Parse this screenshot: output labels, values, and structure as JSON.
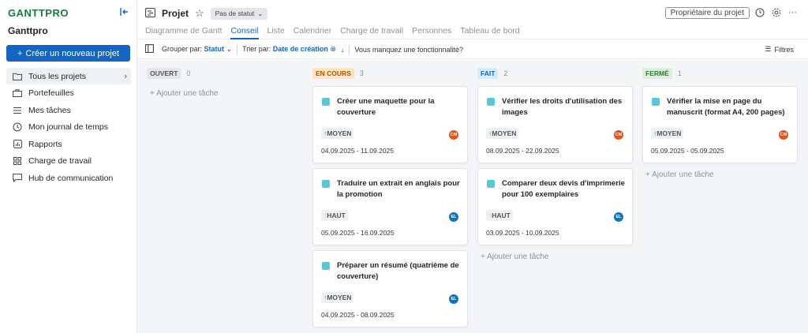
{
  "brand": {
    "logo": "GANTTPRO",
    "workspace": "Ganttpro"
  },
  "sidebar": {
    "new_project": "Créer un nouveau projet",
    "items": [
      {
        "label": "Tous les projets",
        "icon": "folder-icon"
      },
      {
        "label": "Portefeuilles",
        "icon": "briefcase-icon"
      },
      {
        "label": "Mes tâches",
        "icon": "list-icon"
      },
      {
        "label": "Mon journal de temps",
        "icon": "clock-icon"
      },
      {
        "label": "Rapports",
        "icon": "report-icon"
      },
      {
        "label": "Charge de travail",
        "icon": "grid-icon"
      },
      {
        "label": "Hub de communication",
        "icon": "chat-icon"
      }
    ]
  },
  "header": {
    "title": "Projet",
    "status": "Pas de statut",
    "owner_button": "Propriétaire du projet",
    "tabs": [
      "Diagramme de Gantt",
      "Conseil",
      "Liste",
      "Calendrier",
      "Charge de travail",
      "Personnes",
      "Tableau de bord"
    ]
  },
  "toolbar": {
    "group_label": "Grouper par:",
    "group_value": "Statut",
    "sort_label": "Trier par:",
    "sort_value": "Date de création",
    "missing_feature": "Vous manquez une fonctionnalité?",
    "filters": "Filtres"
  },
  "columns": [
    {
      "name": "OUVERT",
      "count": "0",
      "add": "+ Ajouter une tâche",
      "bg": "#e4e6e9",
      "fg": "#555555"
    },
    {
      "name": "EN COURS",
      "count": "3",
      "bg": "#fde3c2",
      "fg": "#a35a00"
    },
    {
      "name": "FAIT",
      "count": "2",
      "add": "+ Ajouter une tâche",
      "bg": "#d7ecfa",
      "fg": "#1565c0"
    },
    {
      "name": "FERMÉ",
      "count": "1",
      "add": "+ Ajouter une tâche",
      "bg": "#dcefdc",
      "fg": "#2e7d32"
    }
  ],
  "cards": {
    "c1": {
      "title": "Créer une maquette pour la couverture",
      "priority": "MOYEN",
      "assignee": "CM",
      "dates": "04.09.2025  -  11.09.2025"
    },
    "c2": {
      "title": "Traduire un extrait en anglais pour la promotion",
      "priority": "HAUT",
      "assignee": "EL",
      "dates": "05.09.2025  -  16.09.2025"
    },
    "c3": {
      "title": "Préparer un résumé (quatrième de couverture)",
      "priority": "MOYEN",
      "assignee": "EL",
      "dates": "04.09.2025  -  08.09.2025"
    },
    "c4": {
      "title": "Vérifier les droits d'utilisation des images",
      "priority": "MOYEN",
      "assignee": "CM",
      "dates": "08.09.2025  -  22.09.2025"
    },
    "c5": {
      "title": "Comparer deux devis d'imprimerie pour 100 exemplaires",
      "priority": "HAUT",
      "assignee": "EL",
      "dates": "03.09.2025  -  10.09.2025"
    },
    "c6": {
      "title": "Vérifier la mise en page du manuscrit (format A4, 200 pages)",
      "priority": "MOYEN",
      "assignee": "CM",
      "dates": "05.09.2025  -  05.09.2025"
    }
  },
  "colors": {
    "accent": "#1565c0",
    "avatar_cm": "#e2521d",
    "avatar_el": "#1273b8",
    "task_square": "#5ac8d3"
  }
}
